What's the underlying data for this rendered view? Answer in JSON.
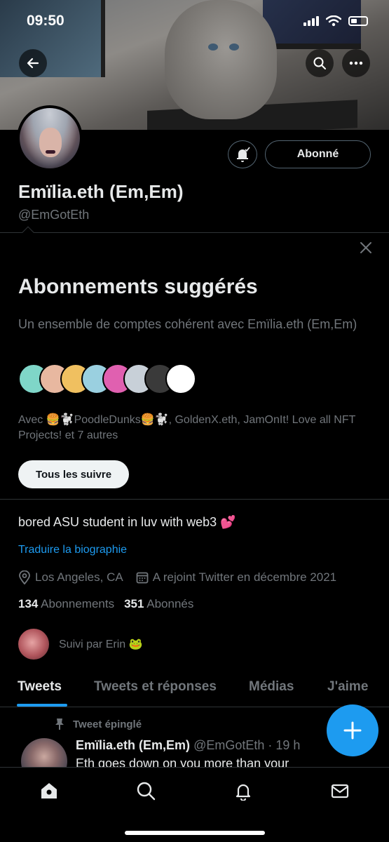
{
  "status_bar": {
    "time": "09:50"
  },
  "profile": {
    "display_name": "Emïlia.eth (Em,Em)",
    "handle": "@EmGotEth",
    "follow_state_label": "Abonné"
  },
  "suggestions": {
    "title": "Abonnements suggérés",
    "description": "Un ensemble de comptes cohérent avec Emïlia.eth (Em,Em)",
    "names_text": "Avec 🍔🐩PoodleDunks🍔🐩, GoldenX.eth, JamOnIt! Love all NFT Projects! et 7 autres",
    "follow_all_label": "Tous les suivre",
    "avatar_colors": [
      "#7fd6c8",
      "#e8b8a0",
      "#f0c060",
      "#9ad0e0",
      "#e060b0",
      "#c8d0d8",
      "#3a3a3a",
      "#ffffff"
    ]
  },
  "bio": {
    "text": "bored ASU student in luv with web3 💕",
    "translate_label": "Traduire la biographie",
    "location": "Los Angeles, CA",
    "joined": "A rejoint Twitter en décembre 2021",
    "following_count": "134",
    "following_label": "Abonnements",
    "followers_count": "351",
    "followers_label": "Abonnés",
    "followed_by": "Suivi par Erin 🐸"
  },
  "tabs": [
    {
      "label": "Tweets"
    },
    {
      "label": "Tweets et réponses"
    },
    {
      "label": "Médias"
    },
    {
      "label": "J'aime"
    }
  ],
  "active_tab": "Tweets",
  "pinned_tweet": {
    "pinned_label": "Tweet épinglé",
    "author_name": "Emïlia.eth (Em,Em)",
    "author_handle": "@EmGotEth",
    "time": "· 19 h",
    "text_preview": "Eth goes down on you more than your"
  },
  "colors": {
    "accent": "#1d9bf0",
    "secondary_text": "#71767b",
    "primary_text": "#e7e9ea",
    "border": "#2f3336"
  }
}
